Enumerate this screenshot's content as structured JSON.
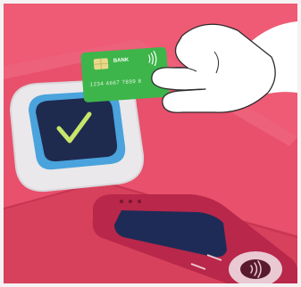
{
  "scene": {
    "colors": {
      "background": "#ef5b75",
      "machine_top": "#e8506c",
      "machine_front": "#d7415c",
      "reader_bezel": "#eae8ea",
      "reader_ring": "#4aa3dc",
      "reader_screen": "#1f2a4f",
      "check": "#c8e66a",
      "card": "#3db54a",
      "chip": "#e8d98a",
      "skin": "#ffffff",
      "terminal_body": "#b9274a",
      "terminal_screen": "#1e2b57"
    },
    "card": {
      "bank_label": "BANK",
      "number": "1234 4667 7899 8"
    },
    "reader": {
      "status": "approved",
      "status_icon": "checkmark-icon"
    },
    "terminal": {
      "contactless_icon": "contactless-icon"
    }
  }
}
